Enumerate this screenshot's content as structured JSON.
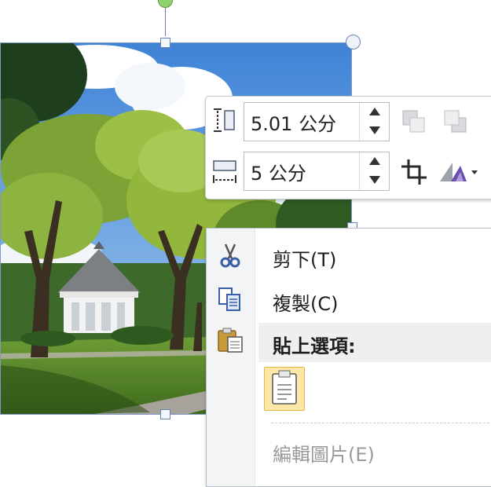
{
  "mini_toolbar": {
    "height": {
      "value": "5.01 公分",
      "icon": "shape-height-icon"
    },
    "width": {
      "value": "5 公分",
      "icon": "shape-width-icon"
    },
    "buttons": [
      {
        "name": "bring-forward-button",
        "icon": "bring-forward-icon"
      },
      {
        "name": "send-backward-button",
        "icon": "send-backward-icon"
      },
      {
        "name": "crop-button",
        "icon": "crop-icon"
      },
      {
        "name": "picture-styles-button",
        "icon": "shape-effects-icon"
      }
    ]
  },
  "context_menu": {
    "cut": {
      "label": "剪下(T)",
      "icon": "scissors-icon"
    },
    "copy": {
      "label": "複製(C)",
      "icon": "copy-icon"
    },
    "paste_header": {
      "label": "貼上選項:",
      "icon": "paste-icon"
    },
    "paste_option_icon": "paste-keep-source-icon",
    "edit_picture": {
      "label": "編輯圖片(E)",
      "disabled": true
    }
  },
  "colors": {
    "selection_border": "#7e9ac4",
    "rotate_handle": "#8fd36e",
    "paste_option_highlight": "#fde7a8"
  }
}
